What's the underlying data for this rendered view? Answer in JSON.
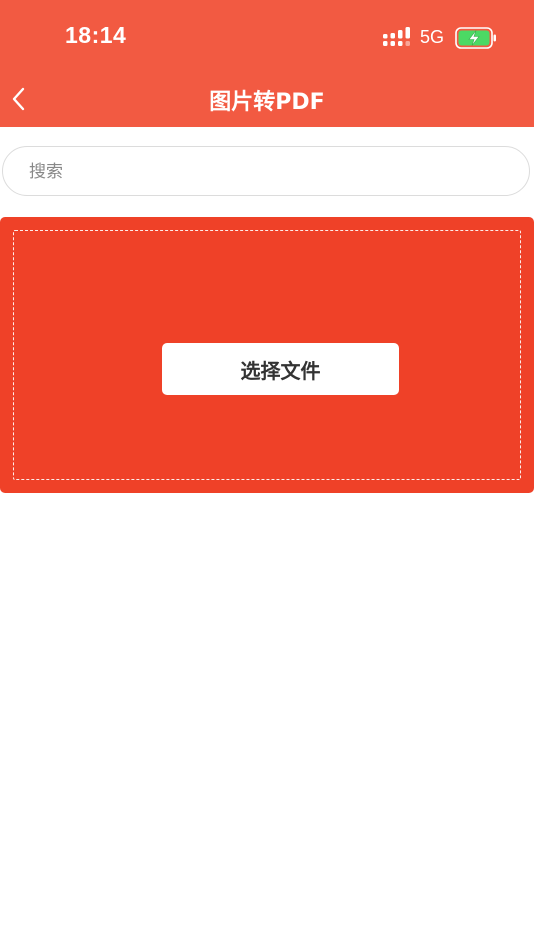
{
  "status_bar": {
    "time": "18:14",
    "network": "5G",
    "signal_icon": "signal-bars-icon",
    "battery_icon": "battery-charging-icon"
  },
  "nav": {
    "back_icon": "chevron-left-icon",
    "title": "图片转PDF"
  },
  "search": {
    "placeholder": "搜索",
    "value": ""
  },
  "upload": {
    "button_label": "选择文件"
  },
  "colors": {
    "header_bg": "#F25A42",
    "upload_bg": "#EF4128",
    "battery_fill": "#4CD964"
  }
}
